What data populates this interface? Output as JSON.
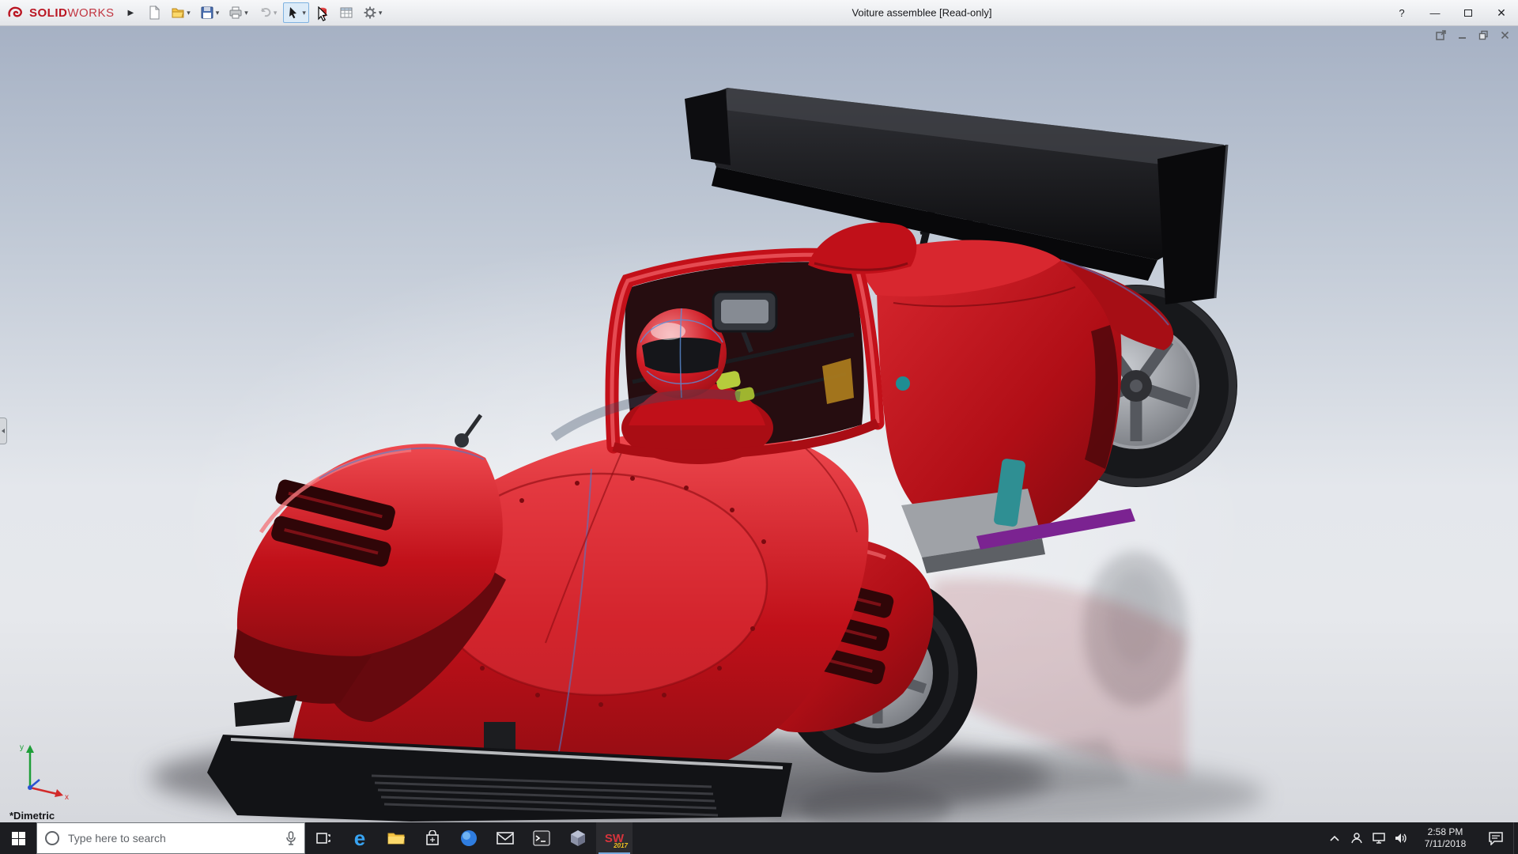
{
  "brand": {
    "solid": "SOLID",
    "works": "WORKS"
  },
  "titlebar": {
    "title": "Voiture assemblee [Read-only]",
    "help_label": "?",
    "toolbar_items": [
      "flyout-arrow",
      "new-document",
      "open",
      "save",
      "print",
      "undo",
      "select",
      "appearance",
      "design-table",
      "options"
    ],
    "window_controls": [
      "minimize",
      "maximize",
      "close"
    ]
  },
  "viewport": {
    "view_label": "*Dimetric",
    "triad": {
      "x": "x",
      "y": "y"
    },
    "doc_controls": [
      "pop-out",
      "minimize",
      "restore",
      "close"
    ],
    "model_name": "red-lemans-prototype-race-car"
  },
  "taskbar": {
    "search": {
      "placeholder": "Type here to search"
    },
    "edge_letter": "e",
    "sw": {
      "letters": "SW",
      "year": "2017"
    },
    "clock": {
      "time": "2:58 PM",
      "date": "7/11/2018"
    },
    "apps": [
      "start",
      "search",
      "task-view",
      "edge",
      "file-explorer",
      "store",
      "browser",
      "mail",
      "command-prompt",
      "cad-viewer",
      "solidworks-2017"
    ],
    "tray": [
      "hidden-icons-chevron",
      "people",
      "network",
      "volume",
      "clock",
      "action-center"
    ]
  },
  "colors": {
    "brand_red": "#ba1522",
    "car_red": "#c01019",
    "wing_black": "#0b0b0d",
    "selection_blue": "#4e79c8",
    "taskbar_bg": "#1c1d21",
    "viewport_top": "#a6b1c4",
    "viewport_bottom": "#d6d8dd"
  }
}
